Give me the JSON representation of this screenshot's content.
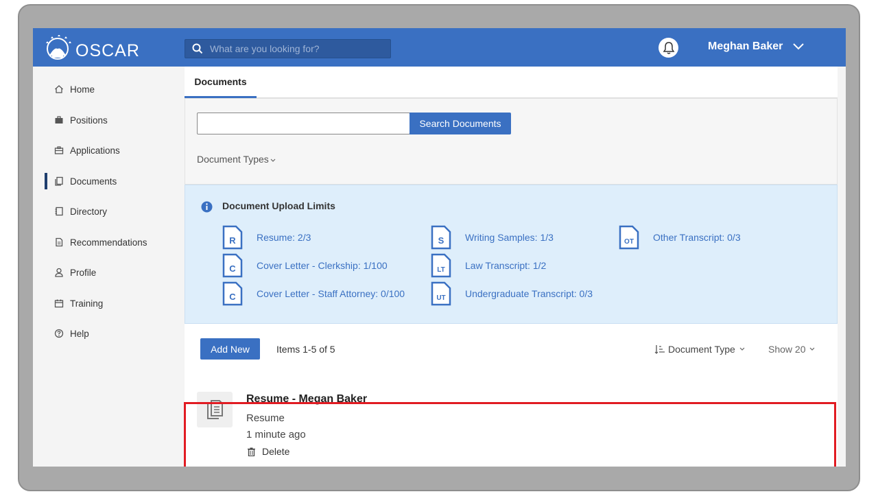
{
  "app": {
    "logo_text": "OSCAR",
    "search": {
      "placeholder": "What are you looking for?"
    },
    "user_name": "Meghan Baker"
  },
  "sidebar": {
    "items": [
      {
        "label": "Home",
        "icon": "home-icon"
      },
      {
        "label": "Positions",
        "icon": "briefcase-icon"
      },
      {
        "label": "Applications",
        "icon": "briefcase-outline-icon"
      },
      {
        "label": "Documents",
        "icon": "documents-icon",
        "active": true
      },
      {
        "label": "Directory",
        "icon": "directory-icon"
      },
      {
        "label": "Recommendations",
        "icon": "document-icon"
      },
      {
        "label": "Profile",
        "icon": "person-icon"
      },
      {
        "label": "Training",
        "icon": "calendar-icon"
      },
      {
        "label": "Help",
        "icon": "help-icon"
      }
    ]
  },
  "tabs": {
    "active": "Documents"
  },
  "filters": {
    "search_value": "",
    "search_button": "Search Documents",
    "document_types_label": "Document Types"
  },
  "upload_limits": {
    "title": "Document Upload Limits",
    "items": [
      {
        "letter": "R",
        "label": "Resume: 2/3"
      },
      {
        "letter": "C",
        "label": "Cover Letter - Clerkship: 1/100"
      },
      {
        "letter": "C",
        "label": "Cover Letter - Staff Attorney: 0/100"
      },
      {
        "letter": "S",
        "label": "Writing Samples: 1/3"
      },
      {
        "letter": "LT",
        "label": "Law Transcript: 1/2"
      },
      {
        "letter": "UT",
        "label": "Undergraduate Transcript: 0/3"
      },
      {
        "letter": "OT",
        "label": "Other Transcript: 0/3"
      }
    ]
  },
  "toolbar": {
    "add_new": "Add New",
    "items_count": "Items 1-5 of 5",
    "sort_label": "Document Type",
    "show_label": "Show 20"
  },
  "documents": [
    {
      "title": "Resume - Megan Baker",
      "type": "Resume",
      "time": "1 minute ago",
      "delete_label": "Delete"
    }
  ],
  "colors": {
    "brand": "#3a70c2",
    "info_bg": "#deeefb",
    "highlight": "#e11b22"
  }
}
